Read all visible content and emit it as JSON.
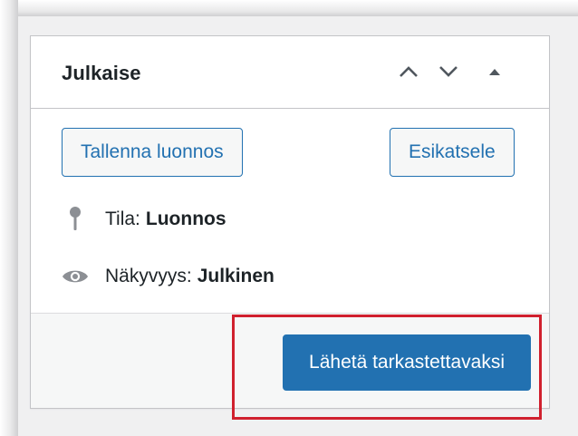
{
  "panel": {
    "title": "Julkaise",
    "header_buttons": [
      {
        "icon": "chevron-up-icon"
      },
      {
        "icon": "chevron-down-icon"
      },
      {
        "icon": "triangle-up-icon"
      }
    ]
  },
  "actions": {
    "save_draft_label": "Tallenna luonnos",
    "preview_label": "Esikatsele"
  },
  "status": {
    "label": "Tila:",
    "value": "Luonnos",
    "icon": "pin-icon"
  },
  "visibility": {
    "label": "Näkyvyys:",
    "value": "Julkinen",
    "icon": "eye-icon"
  },
  "footer": {
    "submit_label": "Lähetä tarkastettavaksi"
  },
  "colors": {
    "primary": "#2271b1",
    "highlight": "#d0202e",
    "border": "#c3c4c7",
    "text": "#1d2327"
  }
}
